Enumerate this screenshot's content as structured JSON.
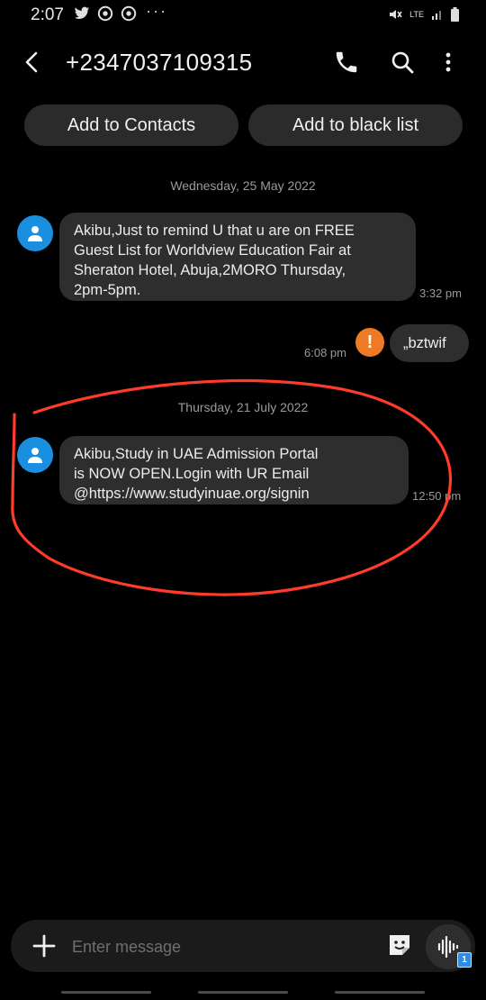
{
  "status": {
    "time": "2:07",
    "network": "LTE",
    "dots": "···"
  },
  "header": {
    "contact_number": "+2347037109315"
  },
  "actions": {
    "add_contacts_label": "Add to Contacts",
    "add_blacklist_label": "Add to black list"
  },
  "conversation": {
    "date1": "Wednesday, 25 May 2022",
    "msg1": {
      "text": "Akibu,Just to remind U that u are on FREE\nGuest List for Worldview Education Fair at\nSheraton Hotel, Abuja,2MORO Thursday,\n2pm-5pm.",
      "time": "3:32 pm"
    },
    "msg2": {
      "text": "„bztwif",
      "time": "6:08 pm",
      "error_icon": "!"
    },
    "date2": "Thursday, 21 July 2022",
    "msg3": {
      "text": "Akibu,Study in UAE Admission Portal\nis NOW OPEN.Login with UR Email\n@https://www.studyinuae.org/signin",
      "time": "12:50 pm"
    }
  },
  "composer": {
    "placeholder": "Enter message",
    "sim_badge": "1"
  },
  "colors": {
    "avatar": "#1a8fe0",
    "error": "#ee7a25",
    "annotation": "#ff3b2a"
  }
}
